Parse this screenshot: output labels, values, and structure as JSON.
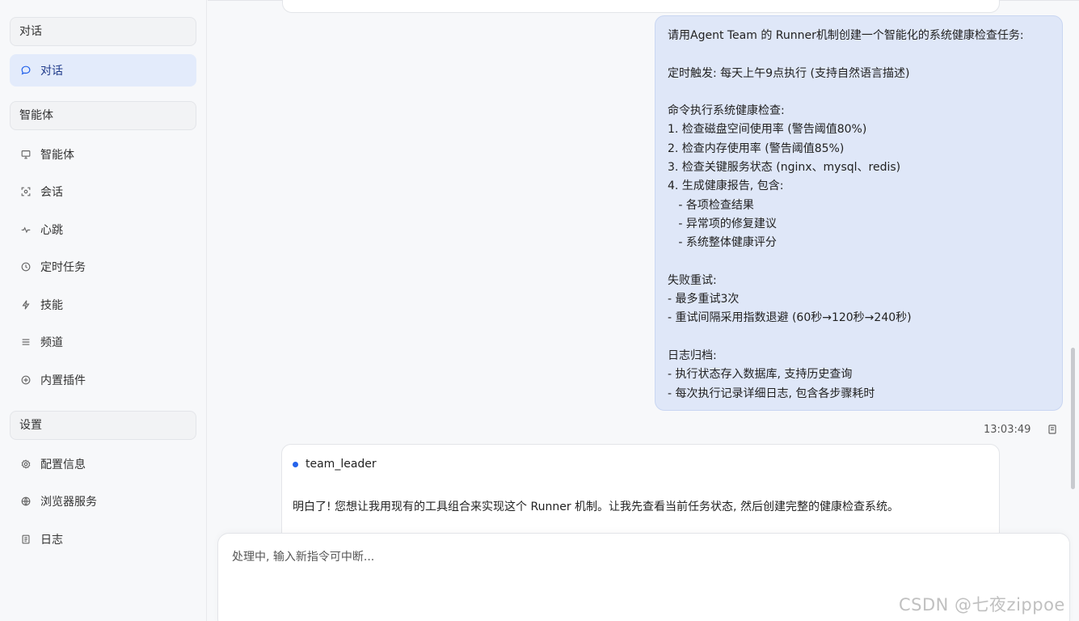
{
  "sidebar": {
    "sections": [
      {
        "header": "对话",
        "items": [
          {
            "label": "对话",
            "icon": "chat-bubble-icon",
            "active": true
          }
        ]
      },
      {
        "header": "智能体",
        "items": [
          {
            "label": "智能体",
            "icon": "monitor-icon"
          },
          {
            "label": "会话",
            "icon": "scan-icon"
          },
          {
            "label": "心跳",
            "icon": "pulse-icon"
          },
          {
            "label": "定时任务",
            "icon": "clock-icon"
          },
          {
            "label": "技能",
            "icon": "lightning-icon"
          },
          {
            "label": "频道",
            "icon": "lines-icon"
          },
          {
            "label": "内置插件",
            "icon": "plus-circle-icon"
          }
        ]
      },
      {
        "header": "设置",
        "items": [
          {
            "label": "配置信息",
            "icon": "gear-icon"
          },
          {
            "label": "浏览器服务",
            "icon": "globe-icon"
          },
          {
            "label": "日志",
            "icon": "document-icon"
          }
        ]
      }
    ]
  },
  "chat": {
    "user_message": {
      "lines": [
        "请用Agent Team 的 Runner机制创建一个智能化的系统健康检查任务:",
        "",
        "定时触发: 每天上午9点执行 (支持自然语言描述)",
        "",
        "命令执行系统健康检查:",
        "1. 检查磁盘空间使用率 (警告阈值80%)",
        "2. 检查内存使用率 (警告阈值85%)",
        "3. 检查关键服务状态 (nginx、mysql、redis)",
        "4. 生成健康报告, 包含:",
        "   - 各项检查结果",
        "   - 异常项的修复建议",
        "   - 系统整体健康评分",
        "",
        "失败重试:",
        "- 最多重试3次",
        "- 重试间隔采用指数退避 (60秒→120秒→240秒)",
        "",
        "日志归档:",
        "- 执行状态存入数据库, 支持历史查询",
        "- 每次执行记录详细日志, 包含各步骤耗时"
      ],
      "time": "13:03:49"
    },
    "agent_message": {
      "name": "team_leader",
      "text": "明白了! 您想让我用现有的工具组合来实现这个 Runner 机制。让我先查看当前任务状态, 然后创建完整的健康检查系统。"
    }
  },
  "input": {
    "placeholder": "处理中, 输入新指令可中断..."
  },
  "watermark": "CSDN @七夜zippoe",
  "colors": {
    "accent": "#2563eb",
    "active_bg": "#e3ebfb",
    "user_bubble_bg": "#dfe7f8"
  }
}
